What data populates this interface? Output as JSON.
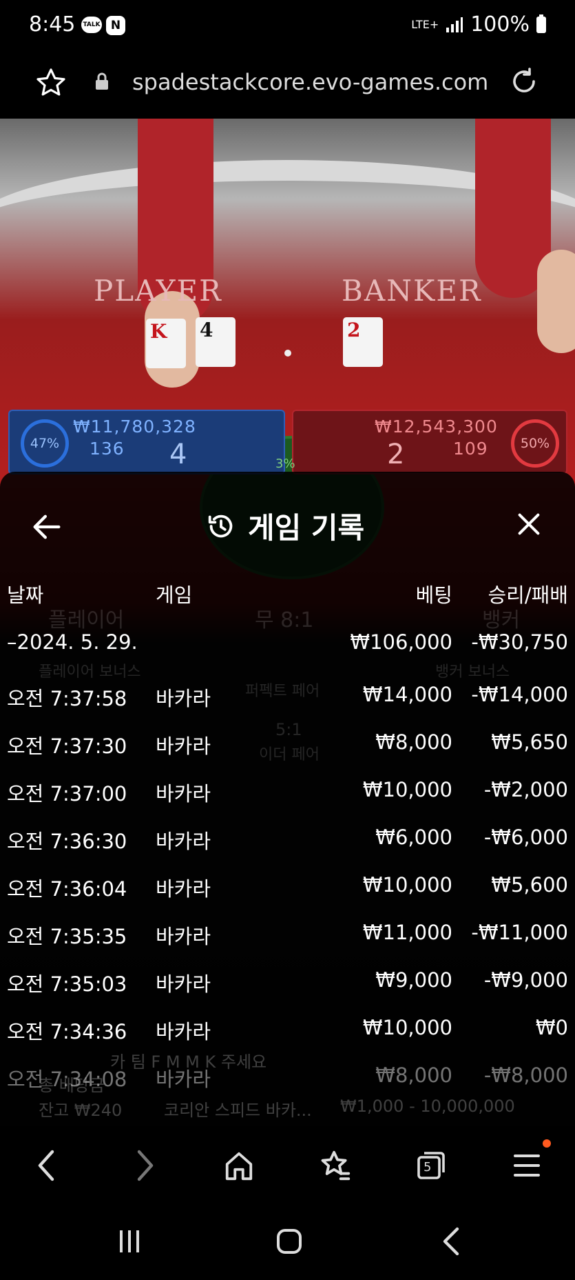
{
  "status_bar": {
    "time": "8:45",
    "app_talk": "TALK",
    "app_n": "N",
    "network": "LTE+",
    "battery": "100%"
  },
  "browser": {
    "url": "spadestackcore.evo-games.com",
    "star_icon": "star-outline-icon",
    "lock_icon": "lock-icon",
    "reload_icon": "reload-icon"
  },
  "table": {
    "player_label": "PLAYER",
    "banker_label": "BANKER",
    "player_cards": [
      "K",
      "4"
    ],
    "banker_cards": [
      "2"
    ],
    "player_pct": "47%",
    "player_amount": "₩11,780,328",
    "player_count": "136",
    "player_score": "4",
    "banker_pct": "50%",
    "banker_amount": "₩12,543,300",
    "banker_count": "109",
    "banker_score": "2",
    "tie_pct": "3%"
  },
  "history": {
    "title": "게임 기록",
    "back_icon": "arrow-left-icon",
    "history_icon": "history-clock-icon",
    "close_icon": "close-icon",
    "columns": {
      "date": "날짜",
      "game": "게임",
      "bet": "베팅",
      "winloss": "승리/패배"
    },
    "summary": {
      "date": "–2024. 5. 29.",
      "bet": "₩106,000",
      "winloss": "-₩30,750"
    },
    "rows": [
      {
        "time": "오전 7:37:58",
        "game": "바카라",
        "bet": "₩14,000",
        "winloss": "-₩14,000"
      },
      {
        "time": "오전 7:37:30",
        "game": "바카라",
        "bet": "₩8,000",
        "winloss": "₩5,650"
      },
      {
        "time": "오전 7:37:00",
        "game": "바카라",
        "bet": "₩10,000",
        "winloss": "-₩2,000"
      },
      {
        "time": "오전 7:36:30",
        "game": "바카라",
        "bet": "₩6,000",
        "winloss": "-₩6,000"
      },
      {
        "time": "오전 7:36:04",
        "game": "바카라",
        "bet": "₩10,000",
        "winloss": "₩5,600"
      },
      {
        "time": "오전 7:35:35",
        "game": "바카라",
        "bet": "₩11,000",
        "winloss": "-₩11,000"
      },
      {
        "time": "오전 7:35:03",
        "game": "바카라",
        "bet": "₩9,000",
        "winloss": "-₩9,000"
      },
      {
        "time": "오전 7:34:36",
        "game": "바카라",
        "bet": "₩10,000",
        "winloss": "₩0"
      },
      {
        "time": "오전 7:34:08",
        "game": "바카라",
        "bet": "₩8,000",
        "winloss": "-₩8,000"
      }
    ]
  },
  "background_ghost": {
    "player_name": "플레이어",
    "tie": "무 8:1",
    "banker_name": "뱅커",
    "player_bonus": "플레이어 보너스",
    "perfect_pair": "퍼펙트 페어",
    "banker_bonus": "뱅커 보너스",
    "either_pair_ratio": "5:1",
    "either_pair": "이더 페어",
    "chat": "카 팀 F M M K 주세요",
    "total_payout": "총 배당금",
    "balance": "잔고 ₩240",
    "table_name": "코리안 스피드 바카...",
    "limits": "₩1,000 - 10,000,000"
  },
  "bottom_nav": {
    "tab_count": "5",
    "icons": [
      "back-icon",
      "forward-icon",
      "home-icon",
      "bookmarks-icon",
      "tabs-icon",
      "menu-icon"
    ]
  },
  "system_nav": {
    "icons": [
      "recents-icon",
      "home-button-icon",
      "system-back-icon"
    ]
  }
}
